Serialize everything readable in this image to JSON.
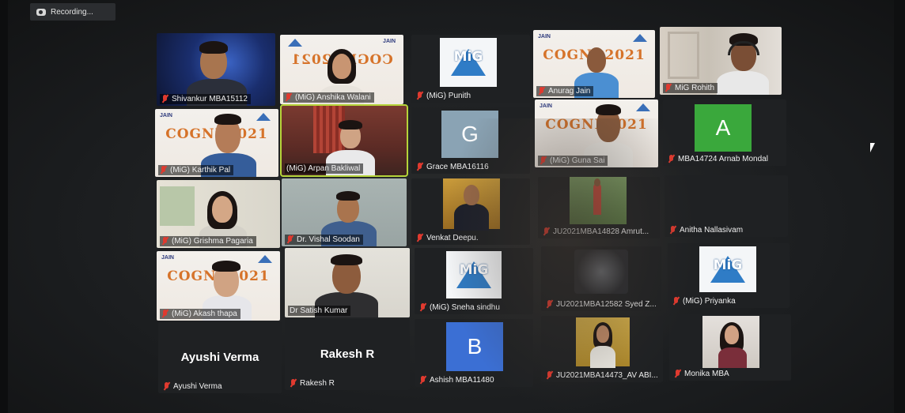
{
  "recording": {
    "label": "Recording..."
  },
  "overlay": {
    "cogni": "COGNI 2021",
    "cogni_left": "COGNI",
    "cogni_right": "2021",
    "jain": "JAIN",
    "mig": "MiG"
  },
  "participants": [
    {
      "name": "Shivankur MBA15112"
    },
    {
      "name": "(MiG) Anshika Walani"
    },
    {
      "name": "(MiG) Punith"
    },
    {
      "name": "Anurag Jain"
    },
    {
      "name": "MiG Rohith"
    },
    {
      "name": "(MiG) Karthik Pal"
    },
    {
      "name": "(MiG) Arpan Bakliwal"
    },
    {
      "name": "Grace MBA16116",
      "avatar": "G",
      "color": "#8aa3b4"
    },
    {
      "name": "(MiG) Guna Sai"
    },
    {
      "name": "MBA14724 Arnab Mondal",
      "avatar": "A",
      "color": "#3aa83c"
    },
    {
      "name": "(MiG) Grishma Pagaria"
    },
    {
      "name": "Dr. Vishal Soodan"
    },
    {
      "name": "Venkat Deepu."
    },
    {
      "name": "JU2021MBA14828 Amrut..."
    },
    {
      "name": "Anitha Nallasivam"
    },
    {
      "name": "(MiG) Akash thapa"
    },
    {
      "name": "Dr Satish Kumar"
    },
    {
      "name": "(MiG) Sneha sindhu"
    },
    {
      "name": "JU2021MBA12582 Syed Z..."
    },
    {
      "name": "(MiG) Priyanka"
    },
    {
      "name": "Ayushi Verma",
      "big": "Ayushi Verma"
    },
    {
      "name": "Rakesh R",
      "big": "Rakesh R"
    },
    {
      "name": "Ashish MBA11480",
      "avatar": "B",
      "color": "#3b6fd4"
    },
    {
      "name": "JU2021MBA14473_AV ABI..."
    },
    {
      "name": "Monika MBA"
    }
  ]
}
